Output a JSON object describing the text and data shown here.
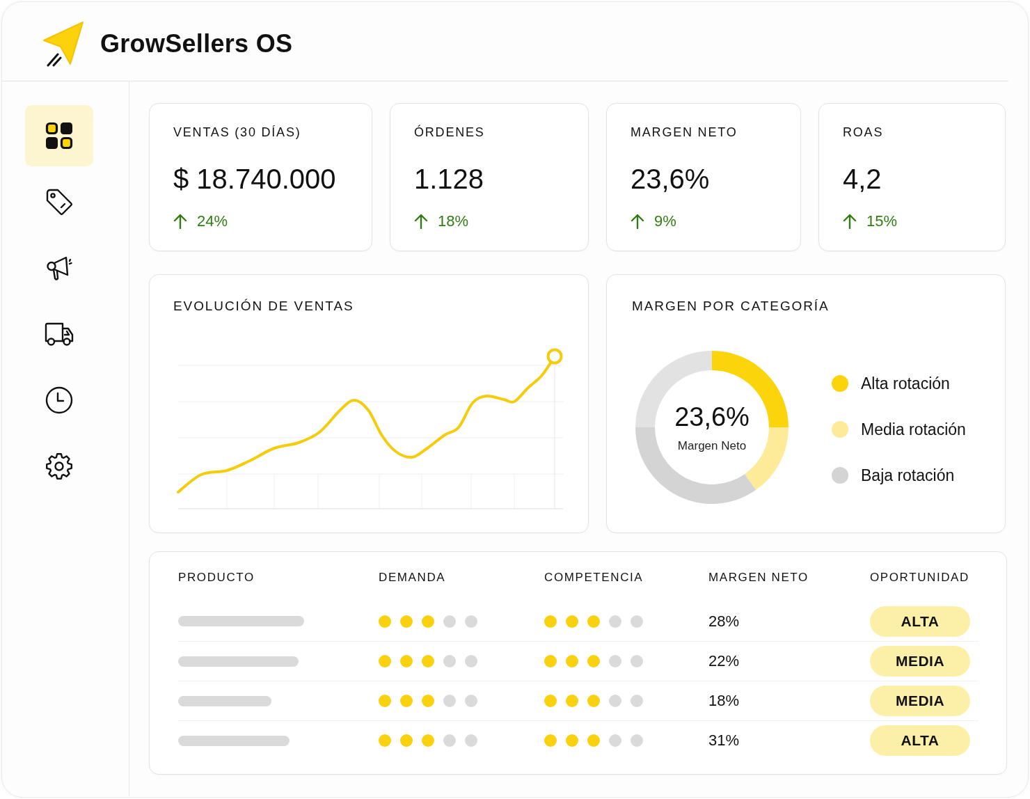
{
  "app": {
    "title": "GrowSellers OS"
  },
  "sidebar": {
    "items": [
      {
        "selected": true
      },
      {
        "selected": false
      },
      {
        "selected": false
      },
      {
        "selected": false
      },
      {
        "selected": false
      },
      {
        "selected": false
      }
    ]
  },
  "kpis": [
    {
      "label": "VENTAS (30 DÍAS)",
      "value": "$ 18.740.000",
      "change": "24%",
      "rising": true
    },
    {
      "label": "ÓRDENES",
      "value": "1.128",
      "change": "18%",
      "rising": true
    },
    {
      "label": "MARGEN NETO",
      "value": "23,6%",
      "change": "9%",
      "rising": true
    },
    {
      "label": "ROAS",
      "value": "4,2",
      "change": "15%",
      "rising": true
    }
  ],
  "sales_chart": {
    "title": "EVOLUCIÓN DE VENTAS"
  },
  "category_chart": {
    "title": "MARGEN POR CATEGORÍA",
    "center_value": "23,6%",
    "center_label": "Margen Neto",
    "legend": [
      {
        "label": "Alta rotación",
        "color": "#fcd40c"
      },
      {
        "label": "Media rotación",
        "color": "#fdeb9a"
      },
      {
        "label": "Baja rotación",
        "color": "#d4d4d4"
      }
    ]
  },
  "table": {
    "columns": [
      "PRODUCTO",
      "DEMANDA",
      "COMPETENCIA",
      "MARGEN NETO",
      "OPORTUNIDAD"
    ],
    "rows": [
      {
        "demanda": {
          "stars": 3
        },
        "competencia": {
          "stars": 3
        },
        "margen_neto": "28%",
        "oportunidad": "ALTA"
      },
      {
        "demanda": {
          "stars": 3
        },
        "competencia": {
          "stars": 3
        },
        "margen_neto": "22%",
        "oportunidad": "MEDIA"
      },
      {
        "demanda": {
          "stars": 3
        },
        "competencia": {
          "stars": 3
        },
        "margen_neto": "18%",
        "oportunidad": "MEDIA"
      },
      {
        "demanda": {
          "stars": 3
        },
        "competencia": {
          "stars": 3
        },
        "margen_neto": "31%",
        "oportunidad": "ALTA"
      }
    ]
  }
}
